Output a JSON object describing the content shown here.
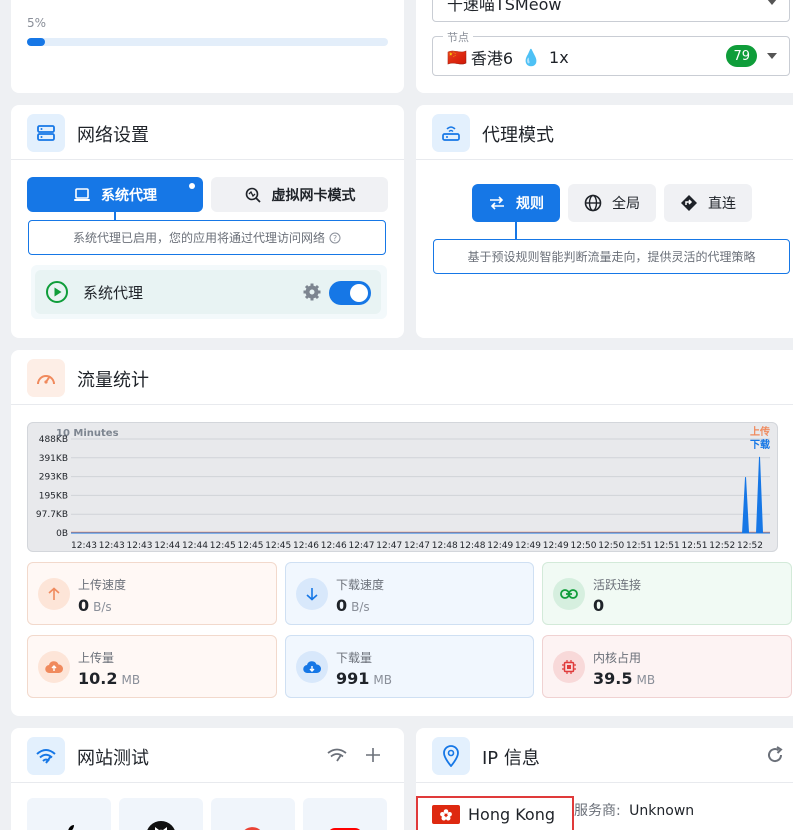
{
  "progress": {
    "label": "5%",
    "value": 0.05
  },
  "group_select": {
    "value": "千速喵TSMeow"
  },
  "node_select": {
    "legend": "节点",
    "flag": "🇨🇳",
    "name": "香港6",
    "drop": "💧",
    "multiplier": "1x",
    "delay": "79"
  },
  "network_settings": {
    "title": "网络设置",
    "tab_system": "系统代理",
    "tab_tun": "虚拟网卡模式",
    "info": "系统代理已启用，您的应用将通过代理访问网络",
    "row_label": "系统代理",
    "enabled": true
  },
  "proxy_mode": {
    "title": "代理模式",
    "modes": [
      {
        "label": "规则",
        "active": true
      },
      {
        "label": "全局",
        "active": false
      },
      {
        "label": "直连",
        "active": false
      }
    ],
    "info": "基于预设规则智能判断流量走向，提供灵活的代理策略"
  },
  "traffic": {
    "title": "流量统计",
    "stats": [
      {
        "label": "上传速度",
        "value": "0",
        "unit": "B/s"
      },
      {
        "label": "下载速度",
        "value": "0",
        "unit": "B/s"
      },
      {
        "label": "活跃连接",
        "value": "0",
        "unit": ""
      },
      {
        "label": "上传量",
        "value": "10.2",
        "unit": "MB"
      },
      {
        "label": "下载量",
        "value": "991",
        "unit": "MB"
      },
      {
        "label": "内核占用",
        "value": "39.5",
        "unit": "MB"
      }
    ]
  },
  "chart_data": {
    "type": "line",
    "title": "10 Minutes",
    "y_tick_labels": [
      "0B",
      "97.7KB",
      "195KB",
      "293KB",
      "391KB",
      "488KB"
    ],
    "ylim": [
      0,
      488
    ],
    "x": [
      "12:43",
      "12:43",
      "12:43",
      "12:44",
      "12:44",
      "12:45",
      "12:45",
      "12:45",
      "12:46",
      "12:46",
      "12:47",
      "12:47",
      "12:47",
      "12:48",
      "12:48",
      "12:49",
      "12:49",
      "12:49",
      "12:50",
      "12:50",
      "12:51",
      "12:51",
      "12:51",
      "12:52",
      "12:52"
    ],
    "grid": true,
    "legend_position": "top-right",
    "series": [
      {
        "name": "上传",
        "color": "#f08a5d",
        "peaks": []
      },
      {
        "name": "下载",
        "color": "#1677e6",
        "peaks": [
          {
            "at": 0.965,
            "value": 290
          },
          {
            "at": 0.985,
            "value": 395
          }
        ]
      }
    ]
  },
  "site_test": {
    "title": "网站测试"
  },
  "ip_info": {
    "title": "IP 信息",
    "country": "Hong Kong",
    "isp_label": "服务商:",
    "isp_value": "Unknown"
  },
  "colors": {
    "accent": "#1677e6",
    "upload": "#f08a5d",
    "download": "#1677e6",
    "success": "#0f9d3a"
  }
}
